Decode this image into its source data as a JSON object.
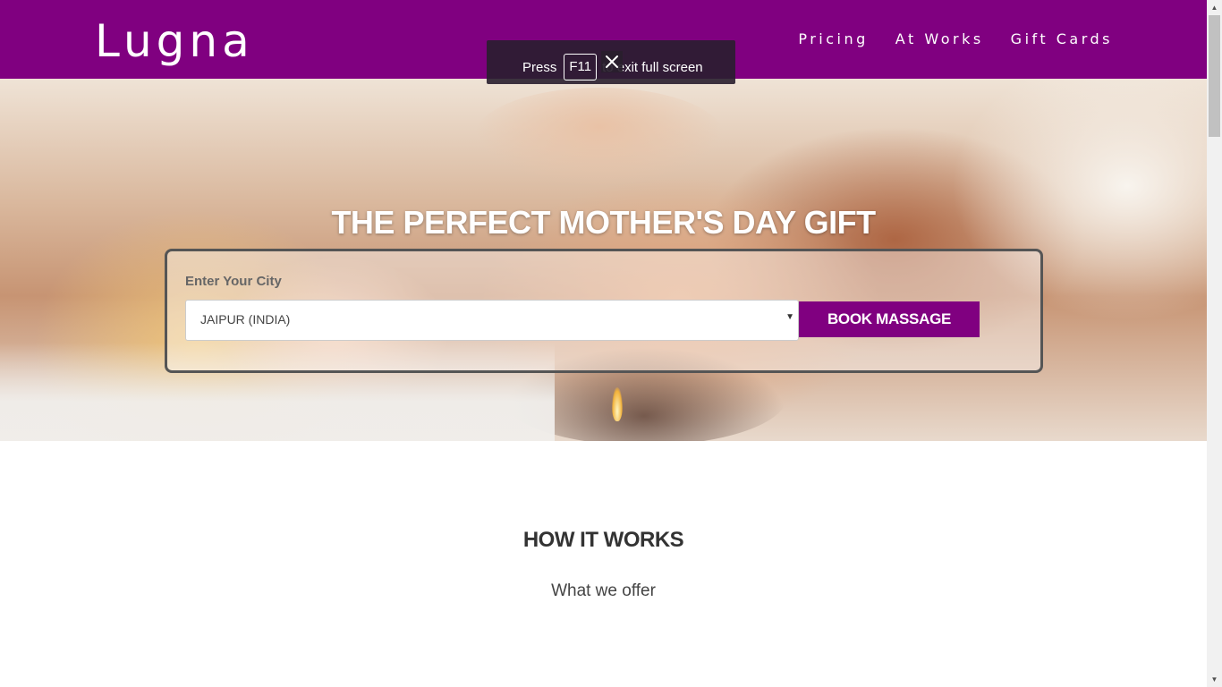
{
  "header": {
    "brand": "Lugna",
    "nav": [
      "Pricing",
      "At Works",
      "Gift Cards"
    ]
  },
  "hero": {
    "title": "THE PERFECT MOTHER'S DAY GIFT",
    "city_label": "Enter Your City",
    "city_selected": "JAIPUR (INDIA)",
    "book_button": "BOOK MASSAGE"
  },
  "fullscreen_toast": {
    "prefix": "Press",
    "key": "F11",
    "suffix": "to exit full screen",
    "close_icon": "close-icon"
  },
  "how_it_works": {
    "title": "HOW IT WORKS",
    "subtitle": "What we offer"
  },
  "colors": {
    "brand_purple": "#800080",
    "overlay_dark": "#281e2d"
  }
}
